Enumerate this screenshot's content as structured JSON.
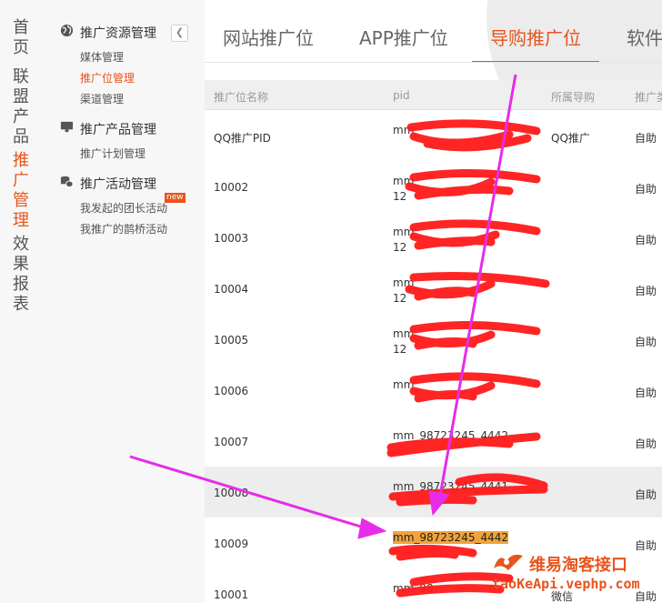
{
  "left_nav": [
    {
      "label": "首页",
      "active": false
    },
    {
      "label": "联盟产品",
      "active": false
    },
    {
      "label": "推广管理",
      "active": true
    },
    {
      "label": "效果报表",
      "active": false
    }
  ],
  "sidebar": {
    "collapse_icon": "chevron-left-icon",
    "groups": [
      {
        "title": "推广资源管理",
        "icon": "globe-icon",
        "items": [
          "媒体管理",
          "推广位管理",
          "渠道管理"
        ],
        "active_item": "推广位管理"
      },
      {
        "title": "推广产品管理",
        "icon": "monitor-icon",
        "items": [
          "推广计划管理"
        ]
      },
      {
        "title": "推广活动管理",
        "icon": "coins-icon",
        "items": [
          "我发起的团长活动",
          "我推广的鹊桥活动"
        ],
        "badge": "new"
      }
    ]
  },
  "tabs": [
    {
      "label": "网站推广位",
      "active": false
    },
    {
      "label": "APP推广位",
      "active": false
    },
    {
      "label": "导购推广位",
      "active": true
    },
    {
      "label": "软件",
      "active": false
    }
  ],
  "table": {
    "headers": [
      "推广位名称",
      "pid",
      "所属导购",
      "推广类"
    ],
    "rows": [
      {
        "name": "QQ推广PID",
        "pid1": "mm_",
        "pid2": "",
        "guide": "QQ推广",
        "type": "自助"
      },
      {
        "name": "10002",
        "pid1": "mm_",
        "pid2": "12",
        "guide": "",
        "type": "自助"
      },
      {
        "name": "10003",
        "pid1": "mm_",
        "pid2": "12",
        "guide": "",
        "type": "自助"
      },
      {
        "name": "10004",
        "pid1": "mm_",
        "pid2": "12",
        "guide": "",
        "type": "自助"
      },
      {
        "name": "10005",
        "pid1": "mm_",
        "pid2": "12",
        "guide": "",
        "type": "自助"
      },
      {
        "name": "10006",
        "pid1": "mm_",
        "pid2": "",
        "guide": "",
        "type": "自助"
      },
      {
        "name": "10007",
        "pid1": "mm_98723245_4442",
        "pid2": "",
        "guide": "",
        "type": "自助"
      },
      {
        "name": "10008",
        "pid1": "mm_98723245_4441",
        "pid2": "",
        "guide": "",
        "type": "自助"
      },
      {
        "name": "10009",
        "pid1": "mm_98723245_4442",
        "pid2": "",
        "guide": "",
        "type": "自助"
      },
      {
        "name": "10001",
        "pid1": "mm_98",
        "pid2": "",
        "guide": "微信",
        "type": "自助"
      }
    ]
  },
  "watermark": {
    "title": "维易淘客接口",
    "url": "taoKeApi.vephp.com"
  },
  "colors": {
    "accent": "#e8541c",
    "highlight": "#f2a33a",
    "annotation_arrow": "#e62ce8",
    "redaction": "#ff1a1a"
  }
}
